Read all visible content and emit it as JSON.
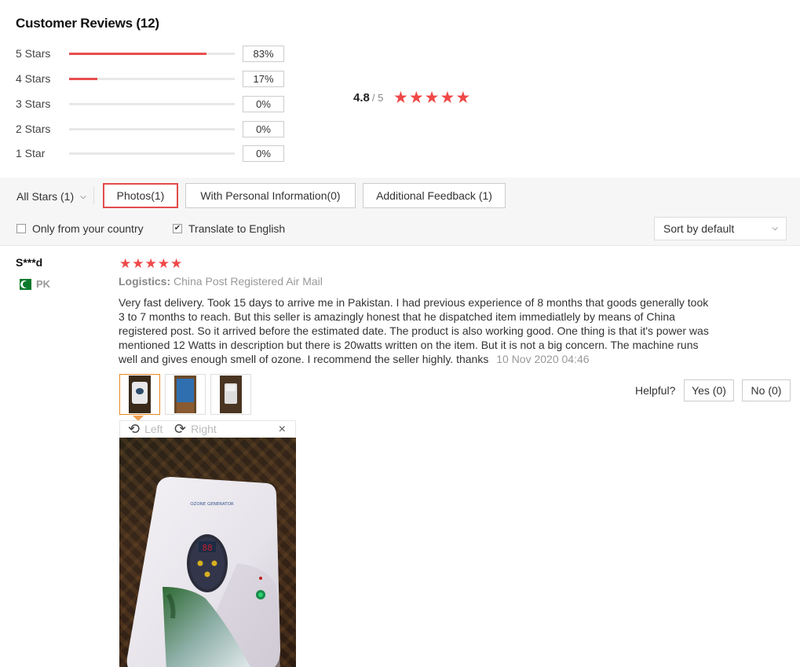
{
  "title": "Customer Reviews (12)",
  "ratings": [
    {
      "label": "5 Stars",
      "percent": "83%",
      "fraction": 0.83
    },
    {
      "label": "4 Stars",
      "percent": "17%",
      "fraction": 0.17
    },
    {
      "label": "3 Stars",
      "percent": "0%",
      "fraction": 0
    },
    {
      "label": "2 Stars",
      "percent": "0%",
      "fraction": 0
    },
    {
      "label": "1 Star",
      "percent": "0%",
      "fraction": 0
    }
  ],
  "average": {
    "value": "4.8",
    "out_of": "/ 5",
    "stars": 5,
    "star_color": "#f04848"
  },
  "filters": {
    "all_stars": "All Stars (1)",
    "photos": "Photos(1)",
    "personal_info": "With Personal Information(0)",
    "additional_feedback": "Additional Feedback (1)",
    "only_country": "Only from your country",
    "only_country_checked": false,
    "translate": "Translate to English",
    "translate_checked": true,
    "sort": "Sort by default"
  },
  "review": {
    "reviewer": "S***d",
    "country": "PK",
    "stars": 5,
    "logistics_label": "Logistics:",
    "logistics_value": "China Post Registered Air Mail",
    "text": "Very fast delivery. Took 15 days to arrive me in Pakistan. I had previous experience of 8 months that goods generally took 3 to 7 months to reach. But this seller is amazingly honest that he dispatched item immediatlely by means of China registered post. So it arrived before the estimated date. The product is also working good. One thing is that it's power was mentioned 12 Watts in description but there is 20watts written on the item. But it is not a big concern. The machine runs well and gives enough smell of ozone. I recommend the seller highly. thanks",
    "date": "10 Nov 2020 04:46",
    "helpful_label": "Helpful?",
    "yes_label": "Yes (0)",
    "no_label": "No (0)",
    "thumbnails": 3
  },
  "viewer": {
    "left_label": "Left",
    "right_label": "Right",
    "close_glyph": "×",
    "device_label": "OZONE GENERATOR",
    "display": "88"
  },
  "colors": {
    "accent": "#e94e4e",
    "star": "#f04848",
    "active_thumb": "#e8891f"
  }
}
